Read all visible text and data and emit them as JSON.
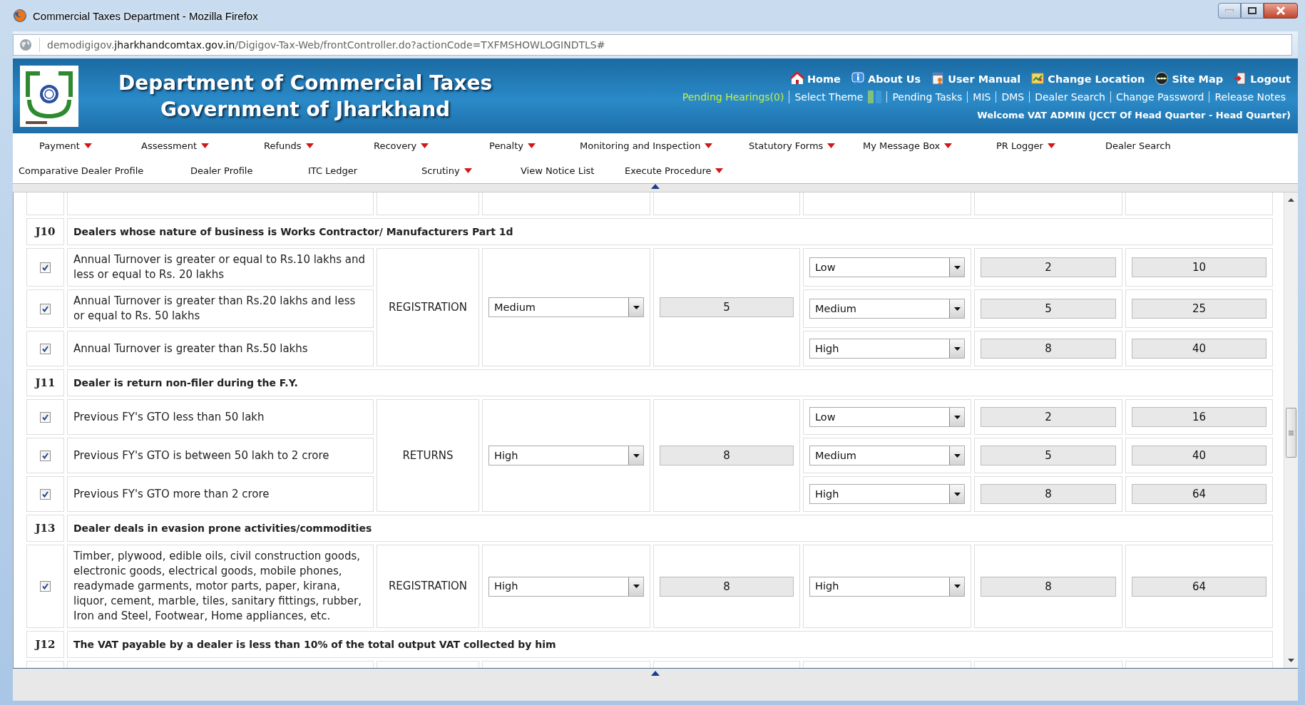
{
  "window": {
    "title": "Commercial Taxes Department - Mozilla Firefox"
  },
  "address_bar": {
    "url_prefix": "demodigigov.",
    "url_domain": "jharkhandcomtax.gov.in",
    "url_path": "/Digigov-Tax-Web/frontController.do?actionCode=TXFMSHOWLOGINDTLS#"
  },
  "header": {
    "title_lines": [
      "Department of Commercial Taxes",
      "Government of Jharkhand"
    ],
    "top_links": [
      "Home",
      "About Us",
      "User Manual",
      "Change Location",
      "Site Map",
      "Logout"
    ],
    "links": [
      {
        "label": "Pending Hearings(0)",
        "kind": "alert"
      },
      {
        "label": "Select Theme",
        "kind": "theme"
      },
      {
        "label": "Pending Tasks",
        "kind": "link"
      },
      {
        "label": "MIS",
        "kind": "link"
      },
      {
        "label": "DMS",
        "kind": "link"
      },
      {
        "label": "Dealer Search",
        "kind": "link"
      },
      {
        "label": "Change Password",
        "kind": "link"
      },
      {
        "label": "Release Notes",
        "kind": "link"
      }
    ],
    "theme_swatches": [
      {
        "color": "#7fbf7f"
      },
      {
        "color": "#3d9ad6"
      }
    ],
    "welcome": "Welcome VAT ADMIN (JCCT Of Head Quarter - Head Quarter)"
  },
  "menu": {
    "rows": [
      [
        {
          "label": "Payment",
          "has_submenu": true
        },
        {
          "label": "Assessment",
          "has_submenu": true
        },
        {
          "label": "Refunds",
          "has_submenu": true
        },
        {
          "label": "Recovery",
          "has_submenu": true
        },
        {
          "label": "Penalty",
          "has_submenu": true
        },
        {
          "label": "Monitoring and Inspection",
          "has_submenu": true
        },
        {
          "label": "Statutory Forms",
          "has_submenu": true
        },
        {
          "label": "My Message Box",
          "has_submenu": true
        },
        {
          "label": "PR Logger",
          "has_submenu": true
        },
        {
          "label": "Dealer Search",
          "has_submenu": false
        }
      ],
      [
        {
          "label": "Comparative Dealer Profile",
          "has_submenu": false
        },
        {
          "label": "Dealer Profile",
          "has_submenu": false
        },
        {
          "label": "ITC Ledger",
          "has_submenu": false
        },
        {
          "label": "Scrutiny",
          "has_submenu": true
        },
        {
          "label": "View Notice List",
          "has_submenu": false
        },
        {
          "label": "Execute Procedure",
          "has_submenu": true
        }
      ]
    ]
  },
  "groups": [
    {
      "code": "J10",
      "title": "Dealers whose nature of business is Works Contractor/ Manufacturers Part 1d",
      "category": "REGISTRATION",
      "default_risk": "Medium",
      "weight": "5",
      "rows": [
        {
          "checked": true,
          "description": "Annual Turnover is greater or equal to Rs.10 lakhs and less or equal to Rs. 20 lakhs",
          "risk": "Low",
          "score": "2",
          "total": "10"
        },
        {
          "checked": true,
          "description": "Annual Turnover is greater than Rs.20 lakhs and less or equal to Rs. 50 lakhs",
          "risk": "Medium",
          "score": "5",
          "total": "25"
        },
        {
          "checked": true,
          "description": "Annual Turnover is greater than Rs.50 lakhs",
          "risk": "High",
          "score": "8",
          "total": "40"
        }
      ]
    },
    {
      "code": "J11",
      "title": "Dealer is return non-filer during the F.Y.",
      "category": "RETURNS",
      "default_risk": "High",
      "weight": "8",
      "rows": [
        {
          "checked": true,
          "description": "Previous FY's GTO less than 50 lakh",
          "risk": "Low",
          "score": "2",
          "total": "16"
        },
        {
          "checked": true,
          "description": "Previous FY's GTO is between 50 lakh to 2 crore",
          "risk": "Medium",
          "score": "5",
          "total": "40"
        },
        {
          "checked": true,
          "description": "Previous FY's GTO more than 2 crore",
          "risk": "High",
          "score": "8",
          "total": "64"
        }
      ]
    },
    {
      "code": "J13",
      "title": "Dealer deals in evasion prone activities/commodities",
      "category": "REGISTRATION",
      "default_risk": "High",
      "weight": "8",
      "rows": [
        {
          "checked": true,
          "description": "Timber, plywood, edible oils, civil construction goods, electronic goods, electrical goods, mobile phones, readymade garments, motor parts, paper, kirana, liquor, cement, marble, tiles, sanitary fittings, rubber, Iron and Steel, Footwear, Home appliances, etc.",
          "risk": "High",
          "score": "8",
          "total": "64"
        }
      ]
    },
    {
      "code": "J12",
      "title": "The VAT payable by a dealer is less than 10% of the total output VAT collected by him"
    }
  ]
}
